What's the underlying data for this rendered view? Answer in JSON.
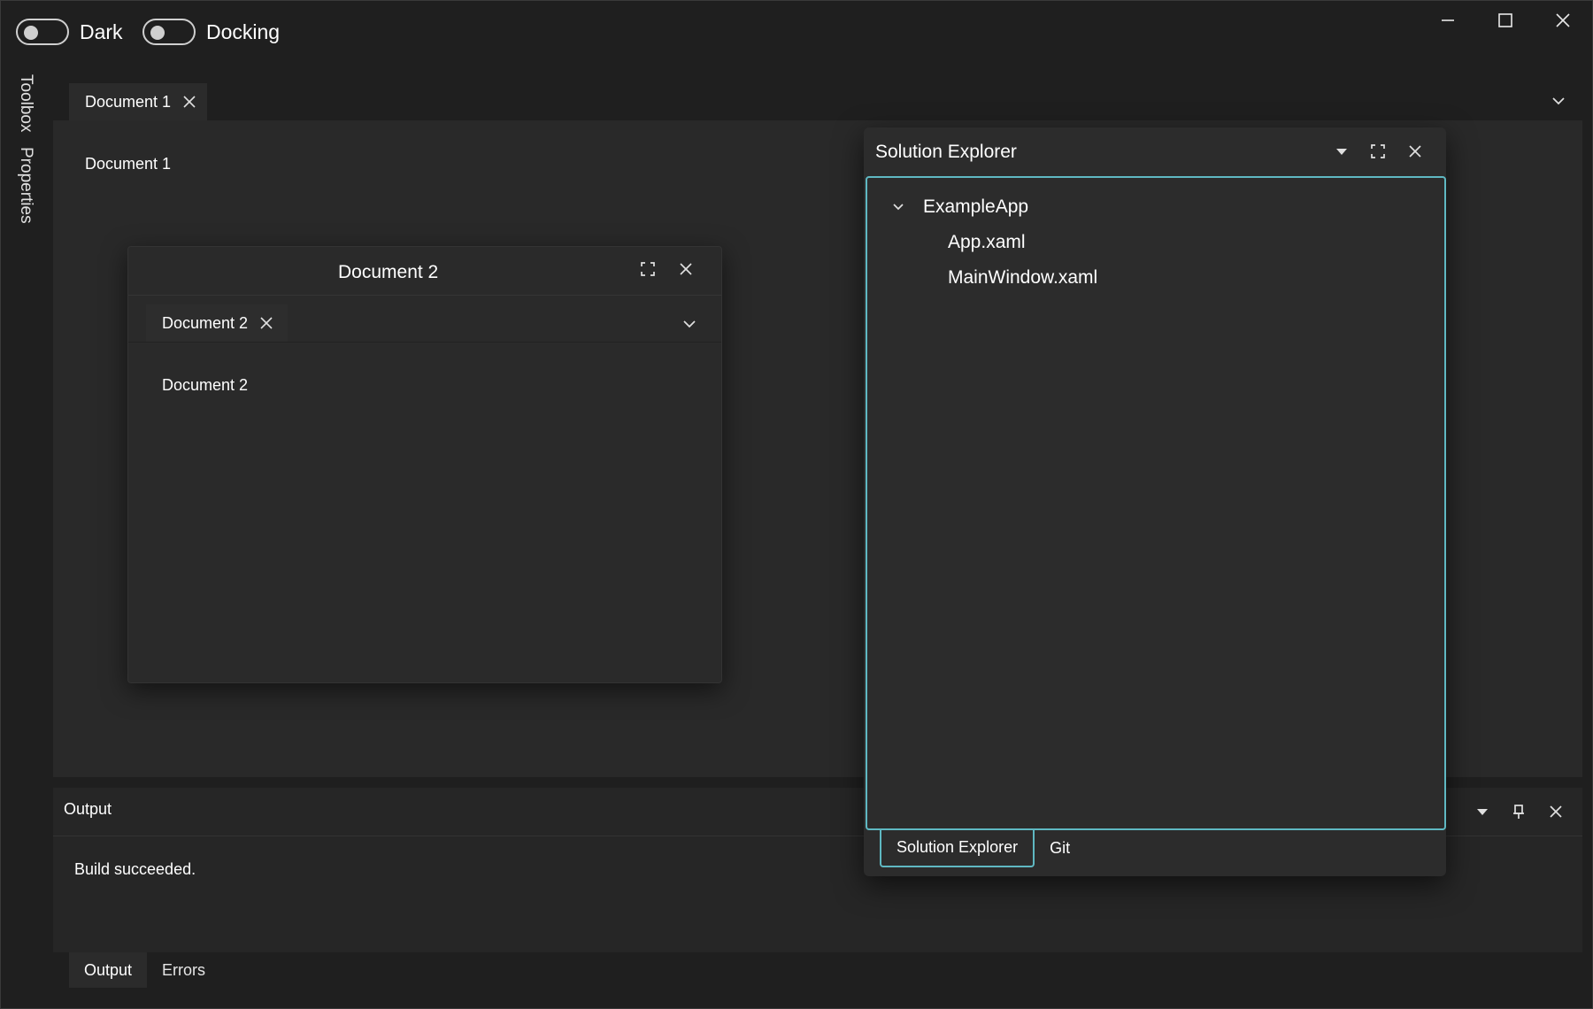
{
  "titlebar": {
    "toggles": [
      {
        "label": "Dark",
        "on": false
      },
      {
        "label": "Docking",
        "on": false
      }
    ],
    "window_buttons": [
      "minimize-icon",
      "maximize-icon",
      "close-icon"
    ]
  },
  "sidebar": {
    "items": [
      {
        "label": "Toolbox"
      },
      {
        "label": "Properties"
      }
    ]
  },
  "document_area": {
    "tab_label": "Document 1",
    "content_text": "Document 1"
  },
  "floating_document": {
    "title": "Document 2",
    "tab_label": "Document 2",
    "content_text": "Document 2"
  },
  "solution_explorer": {
    "title": "Solution Explorer",
    "tree": {
      "root": "ExampleApp",
      "children": [
        "App.xaml",
        "MainWindow.xaml"
      ]
    },
    "tabs": [
      {
        "label": "Solution Explorer",
        "active": true
      },
      {
        "label": "Git",
        "active": false
      }
    ],
    "accent_color": "#5fb8c2"
  },
  "output_panel": {
    "title": "Output",
    "content_text": "Build succeeded.",
    "tabs": [
      {
        "label": "Output",
        "active": true
      },
      {
        "label": "Errors",
        "active": false
      }
    ]
  }
}
